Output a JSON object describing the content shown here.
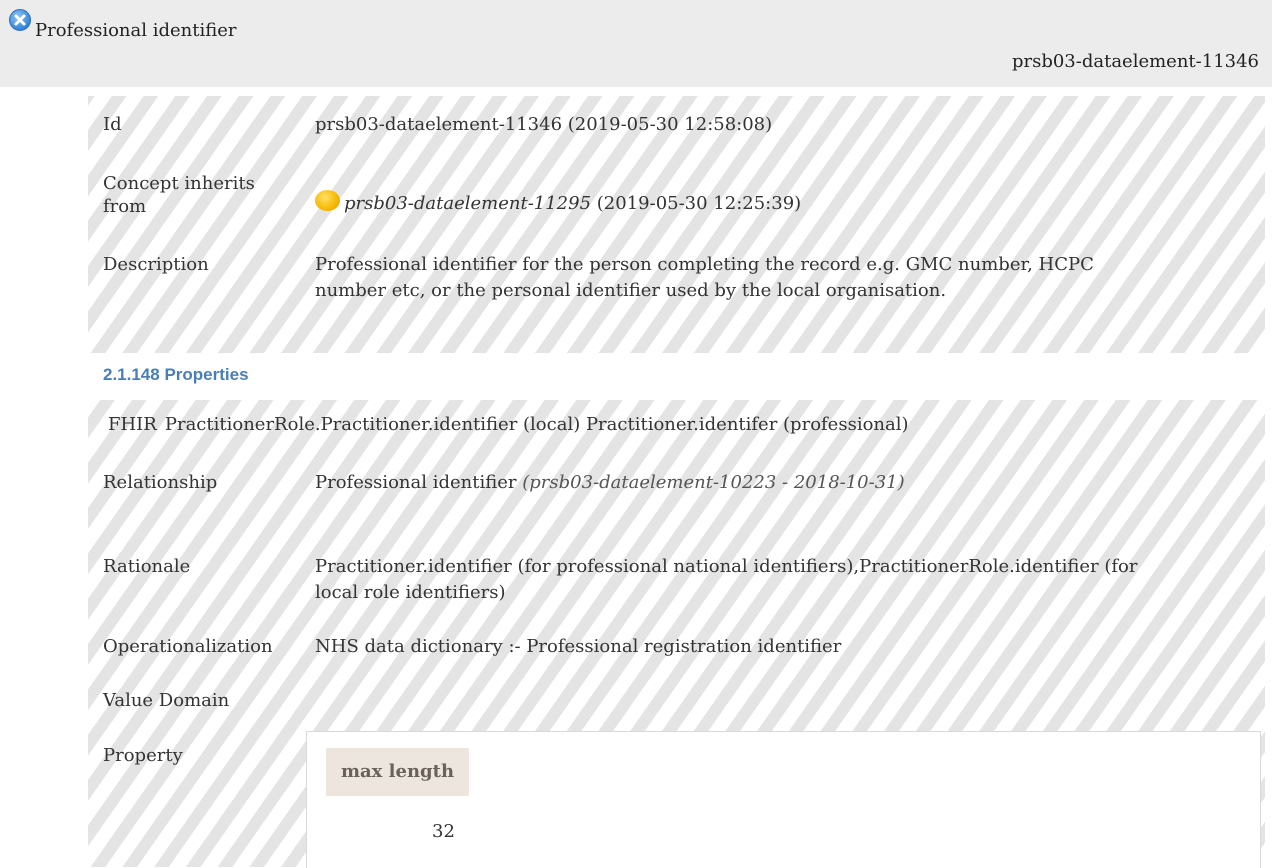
{
  "header": {
    "status_icon": "blue-x-circle-icon",
    "title": "Professional identifier",
    "id": "prsb03-dataelement-11346"
  },
  "details": {
    "id_label": "Id",
    "id_value": "prsb03-dataelement-11346 (2019-05-30 12:58:08)",
    "inherits_label_1": "Concept inherits",
    "inherits_label_2": "from",
    "inherits_icon": "orange-circle-icon",
    "inherits_link": "prsb03-dataelement-11295",
    "inherits_date": "(2019-05-30 12:25:39)",
    "description_label": "Description",
    "description_line1": "Professional identifier for the person completing the record e.g. GMC number, HCPC",
    "description_line2": "number etc, or the personal identifier used by the local organisation."
  },
  "properties": {
    "heading": "2.1.148 Properties",
    "fhir_label": "FHIR",
    "fhir_value": "PractitionerRole.Practitioner.identifier (local) Practitioner.identifer (professional)",
    "relationship_label": "Relationship",
    "relationship_value": "Professional identifier",
    "relationship_ref": "(prsb03-dataelement-10223 - 2018-10-31)",
    "rationale_label": "Rationale",
    "rationale_line1": "Practitioner.identifier (for professional national identifiers),PractitionerRole.identifier (for",
    "rationale_line2": "local role identifiers)",
    "operationalization_label": "Operationalization",
    "operationalization_value": "NHS data dictionary :- Professional registration identifier",
    "value_domain_label": "Value Domain",
    "property_label": "Property",
    "property_table": {
      "header": "max length",
      "value": "32"
    }
  },
  "colors": {
    "header_bg": "#ececec",
    "heading_blue": "#4a7fb5",
    "stripe": "#e4e4e4",
    "table_header_bg": "#ece6df"
  }
}
